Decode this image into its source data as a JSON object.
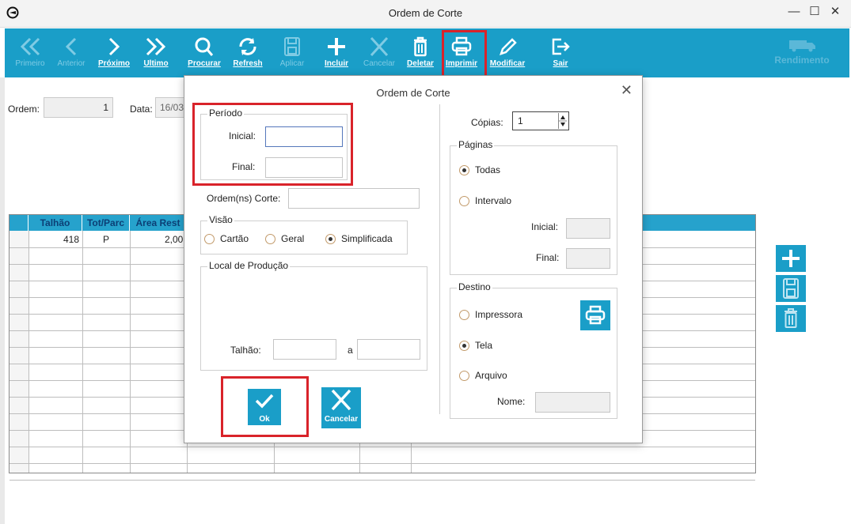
{
  "window": {
    "title": "Ordem de Corte",
    "minimize": "—",
    "maximize": "☐",
    "close": "✕"
  },
  "toolbar": {
    "primeiro": "Primeiro",
    "anterior": "Anterior",
    "proximo": "Próximo",
    "ultimo": "Ultimo",
    "procurar": "Procurar",
    "refresh": "Refresh",
    "aplicar": "Aplicar",
    "incluir": "Incluir",
    "cancelar": "Cancelar",
    "deletar": "Deletar",
    "imprimir": "Imprimir",
    "modificar": "Modificar",
    "sair": "Sair",
    "rendimento": "Rendimento"
  },
  "form": {
    "ordem_label": "Ordem:",
    "ordem_value": "1",
    "data_label": "Data:",
    "data_value": "16/03"
  },
  "grid": {
    "columns": [
      "Talhão",
      "Tot/Parc",
      "Área Rest"
    ],
    "rows": [
      {
        "talhao": "418",
        "tot_parc": "P",
        "area_rest": "2,00"
      }
    ]
  },
  "dialog": {
    "title": "Ordem de Corte",
    "close": "✕",
    "periodo": {
      "title": "Período",
      "inicial_label": "Inicial:",
      "final_label": "Final:",
      "inicial_value": "",
      "final_value": ""
    },
    "ordens_label": "Ordem(ns) Corte:",
    "ordens_value": "",
    "visao": {
      "title": "Visão",
      "options": [
        "Cartão",
        "Geral",
        "Simplificada"
      ],
      "selected": "Simplificada"
    },
    "local": {
      "title": "Local de Produção",
      "talhao_label": "Talhão:",
      "a_label": "a"
    },
    "copias": {
      "label": "Cópias:",
      "value": "1"
    },
    "paginas": {
      "title": "Páginas",
      "todas": "Todas",
      "intervalo": "Intervalo",
      "inicial_label": "Inicial:",
      "final_label": "Final:",
      "selected": "Todas"
    },
    "destino": {
      "title": "Destino",
      "impressora": "Impressora",
      "tela": "Tela",
      "arquivo": "Arquivo",
      "nome_label": "Nome:",
      "selected": "Tela"
    },
    "ok_label": "Ok",
    "cancelar_label": "Cancelar"
  },
  "colors": {
    "accent": "#1a9ec8",
    "highlight": "#d9232a",
    "header_text": "#0c3f75"
  }
}
